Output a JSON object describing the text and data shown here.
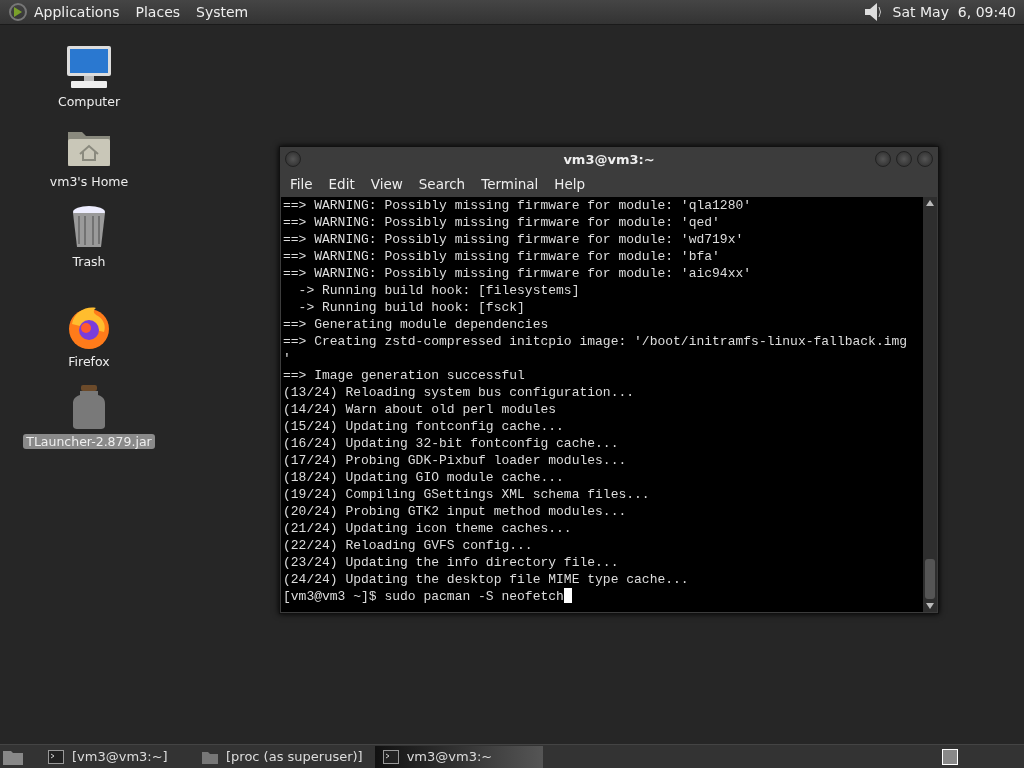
{
  "top_panel": {
    "menus": [
      "Applications",
      "Places",
      "System"
    ],
    "clock": "Sat May  6, 09:40"
  },
  "desktop_icons": [
    {
      "label": "Computer",
      "kind": "computer",
      "selected": false
    },
    {
      "label": "vm3's Home",
      "kind": "home",
      "selected": false
    },
    {
      "label": "Trash",
      "kind": "trash",
      "selected": false
    },
    {
      "label": "Firefox",
      "kind": "firefox",
      "selected": false
    },
    {
      "label": "TLauncher-2.879.jar",
      "kind": "jar",
      "selected": true
    }
  ],
  "window": {
    "title": "vm3@vm3:~",
    "menu": [
      "File",
      "Edit",
      "View",
      "Search",
      "Terminal",
      "Help"
    ],
    "lines": [
      "==> WARNING: Possibly missing firmware for module: 'qla1280'",
      "==> WARNING: Possibly missing firmware for module: 'qed'",
      "==> WARNING: Possibly missing firmware for module: 'wd719x'",
      "==> WARNING: Possibly missing firmware for module: 'bfa'",
      "==> WARNING: Possibly missing firmware for module: 'aic94xx'",
      "  -> Running build hook: [filesystems]",
      "  -> Running build hook: [fsck]",
      "==> Generating module dependencies",
      "==> Creating zstd-compressed initcpio image: '/boot/initramfs-linux-fallback.img",
      "'",
      "==> Image generation successful",
      "(13/24) Reloading system bus configuration...",
      "(14/24) Warn about old perl modules",
      "(15/24) Updating fontconfig cache...",
      "(16/24) Updating 32-bit fontconfig cache...",
      "(17/24) Probing GDK-Pixbuf loader modules...",
      "(18/24) Updating GIO module cache...",
      "(19/24) Compiling GSettings XML schema files...",
      "(20/24) Probing GTK2 input method modules...",
      "(21/24) Updating icon theme caches...",
      "(22/24) Reloading GVFS config...",
      "(23/24) Updating the info directory file...",
      "(24/24) Updating the desktop file MIME type cache..."
    ],
    "prompt": "[vm3@vm3 ~]$ sudo pacman -S neofetch"
  },
  "taskbar": [
    {
      "label": "[vm3@vm3:~]",
      "kind": "terminal",
      "selected": false
    },
    {
      "label": "[proc (as superuser)]",
      "kind": "folder",
      "selected": false
    },
    {
      "label": "vm3@vm3:~",
      "kind": "terminal",
      "selected": true
    }
  ]
}
